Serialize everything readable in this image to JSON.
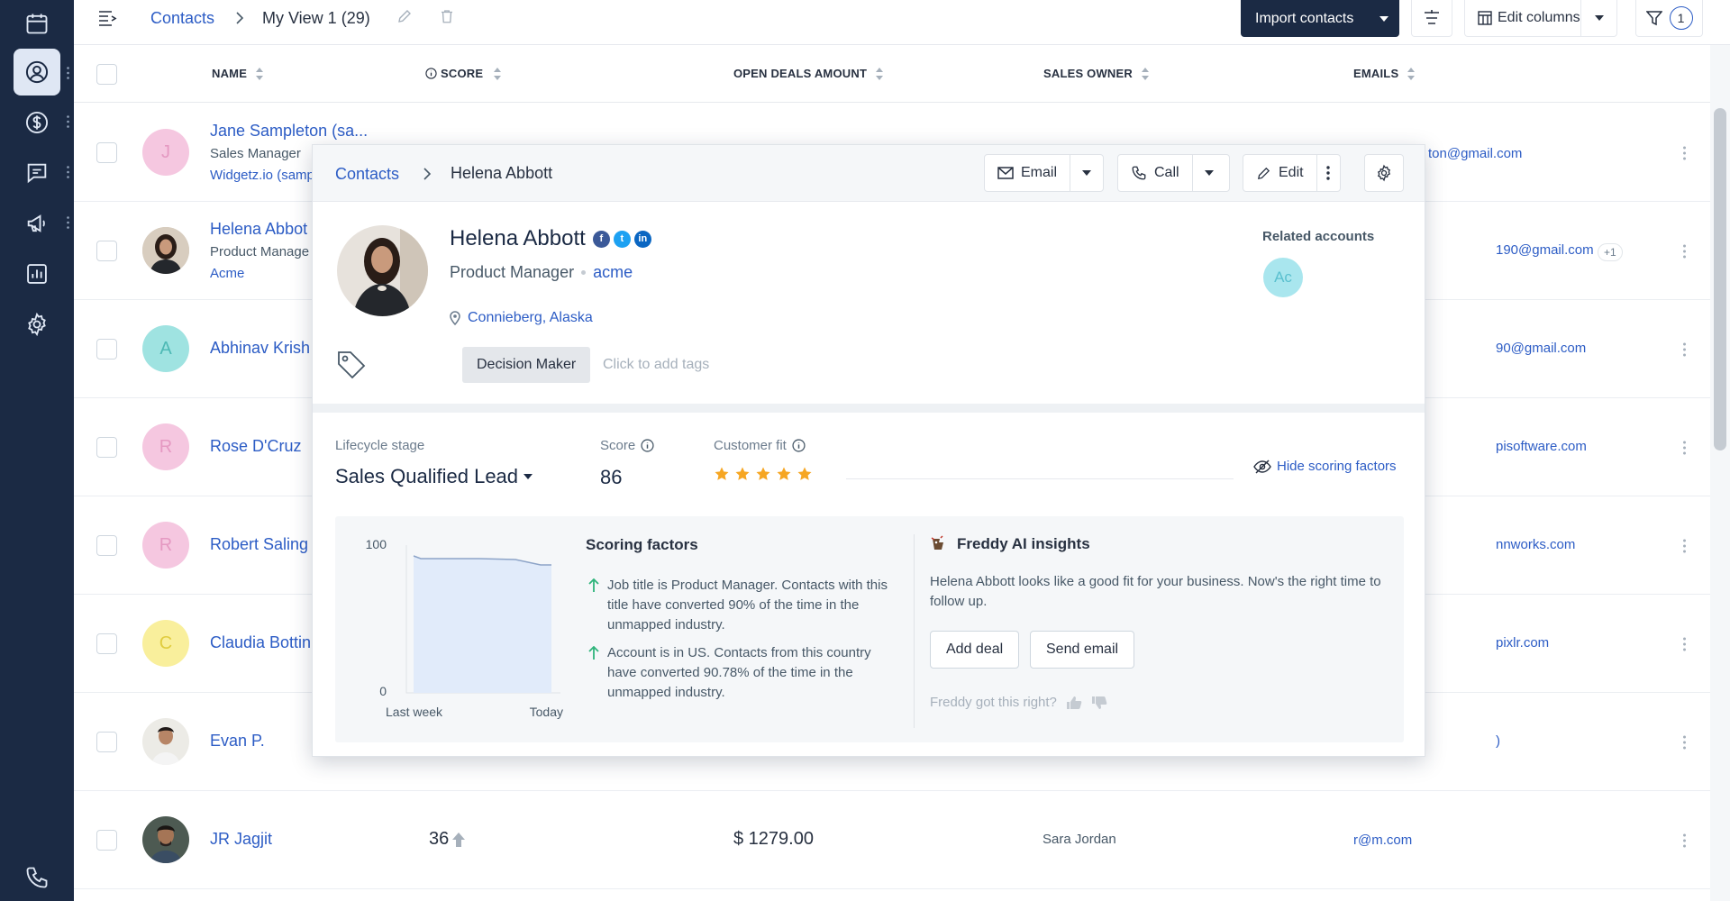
{
  "rail": {
    "items": [
      {
        "icon": "calendar-icon"
      },
      {
        "icon": "contacts-icon",
        "active": true
      },
      {
        "icon": "dollar-icon"
      },
      {
        "icon": "chat-icon"
      },
      {
        "icon": "megaphone-icon"
      },
      {
        "icon": "reports-icon"
      },
      {
        "icon": "settings-icon"
      },
      {
        "icon": "phone-icon"
      }
    ]
  },
  "topbar": {
    "breadcrumb_root": "Contacts",
    "view_name": "My View 1 (29)",
    "import_label": "Import contacts",
    "edit_columns_label": "Edit columns",
    "filter_count": "1"
  },
  "table": {
    "columns": [
      "NAME",
      "SCORE",
      "OPEN DEALS AMOUNT",
      "SALES OWNER",
      "EMAILS"
    ],
    "rows": [
      {
        "initial": "J",
        "avatar_color": "pink",
        "name": "Jane Sampleton (sa...",
        "title": "Sales Manager",
        "company": "Widgetz.io (samp",
        "email": "ton@gmail.com"
      },
      {
        "initial": "",
        "avatar_color": "photo",
        "name": "Helena Abbot",
        "title": "Product Manage",
        "company": "Acme",
        "email": "190@gmail.com",
        "extra": "+1"
      },
      {
        "initial": "A",
        "avatar_color": "teal",
        "name": "Abhinav Krish",
        "email": "90@gmail.com"
      },
      {
        "initial": "R",
        "avatar_color": "pink",
        "name": "Rose D'Cruz",
        "email": "pisoftware.com"
      },
      {
        "initial": "R",
        "avatar_color": "pink",
        "name": "Robert Saling",
        "email": "nnworks.com"
      },
      {
        "initial": "C",
        "avatar_color": "yellow",
        "name": "Claudia Bottin",
        "email": "pixlr.com"
      },
      {
        "initial": "",
        "avatar_color": "photo",
        "name": "Evan P.",
        "email": ")"
      },
      {
        "initial": "",
        "avatar_color": "photo",
        "name": "JR Jagjit",
        "score": "36",
        "deal": "$ 1279.00",
        "owner": "Sara Jordan",
        "email": "r@m.com"
      }
    ]
  },
  "card": {
    "breadcrumb_root": "Contacts",
    "breadcrumb_current": "Helena Abbott",
    "email_btn": "Email",
    "call_btn": "Call",
    "edit_btn": "Edit",
    "name": "Helena Abbott",
    "role": "Product Manager",
    "company": "acme",
    "location": "Connieberg, Alaska",
    "tag": "Decision Maker",
    "tag_placeholder": "Click to add tags",
    "related_title": "Related accounts",
    "related_initials": "Ac",
    "lifecycle_label": "Lifecycle stage",
    "lifecycle_value": "Sales Qualified Lead",
    "score_label": "Score",
    "score_value": "86",
    "fit_label": "Customer fit",
    "fit_stars": 5,
    "hide_scoring": "Hide scoring factors",
    "chart": {
      "y_top": "100",
      "y_bottom": "0",
      "x_start": "Last week",
      "x_end": "Today"
    },
    "scoring_title": "Scoring factors",
    "factors": [
      "Job title is Product Manager. Contacts with this title have converted 90% of the time in the unmapped industry.",
      "Account is in US. Contacts from this country have converted 90.78% of the time in the unmapped industry."
    ],
    "freddy_title": "Freddy AI insights",
    "freddy_text": "Helena Abbott looks like a good fit for your business. Now's the right time to follow up.",
    "add_deal": "Add deal",
    "send_email": "Send email",
    "freddy_ask": "Freddy got this right?"
  },
  "colors": {
    "rail_bg": "#1b2a44",
    "link": "#2c5cc5",
    "star": "#f6a623",
    "arrow_green": "#2fb47c"
  }
}
